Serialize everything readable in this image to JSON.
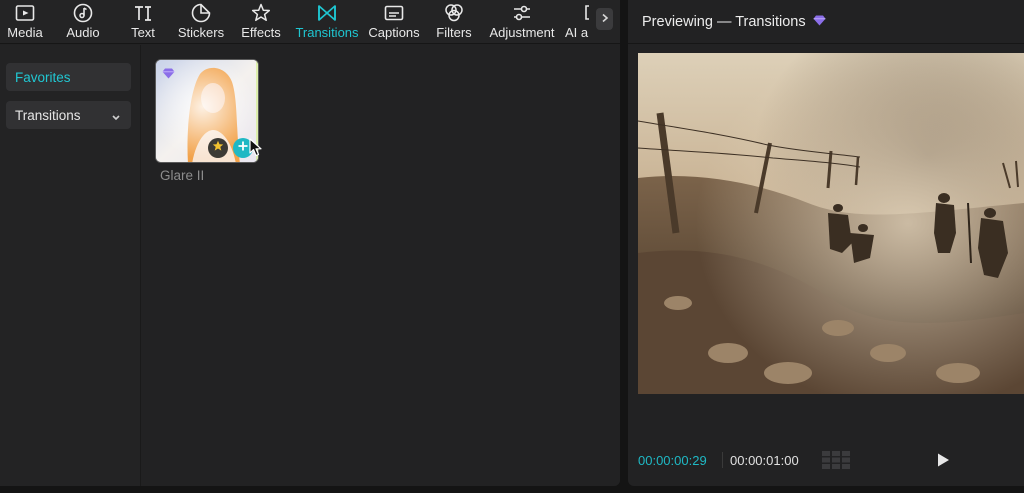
{
  "toolbar": {
    "items": [
      {
        "label": "Media",
        "icon": "media-icon"
      },
      {
        "label": "Audio",
        "icon": "audio-icon"
      },
      {
        "label": "Text",
        "icon": "text-icon"
      },
      {
        "label": "Stickers",
        "icon": "stickers-icon"
      },
      {
        "label": "Effects",
        "icon": "effects-icon"
      },
      {
        "label": "Transitions",
        "icon": "transitions-icon",
        "active": true
      },
      {
        "label": "Captions",
        "icon": "captions-icon"
      },
      {
        "label": "Filters",
        "icon": "filters-icon"
      },
      {
        "label": "Adjustment",
        "icon": "adjustment-icon"
      },
      {
        "label": "AI a",
        "icon": "ai-icon"
      }
    ],
    "more_icon": "chevron-right-icon"
  },
  "sidebar": {
    "items": [
      {
        "label": "Favorites",
        "selected": true
      },
      {
        "label": "Transitions",
        "expandable": true
      }
    ]
  },
  "assets": [
    {
      "label": "Glare II",
      "pro": true
    }
  ],
  "preview": {
    "title": "Previewing — Transitions",
    "current_time": "00:00:00:29",
    "total_time": "00:00:01:00"
  },
  "colors": {
    "accent": "#1fc6d1",
    "pro_badge": "#8b6ee8",
    "panel_bg": "#222223",
    "app_bg": "#141414"
  }
}
